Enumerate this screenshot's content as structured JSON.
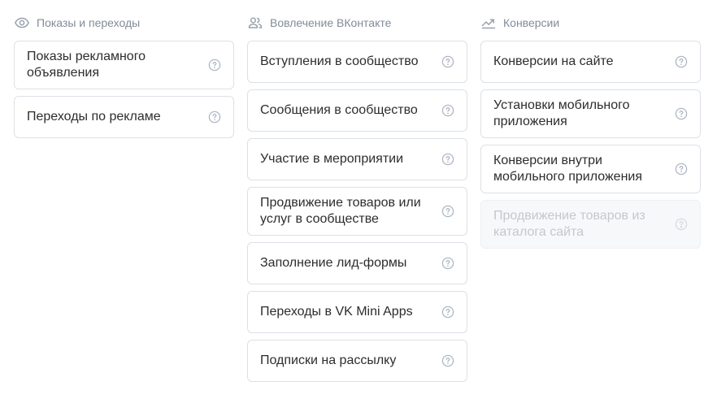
{
  "colors": {
    "header_text": "#818c99",
    "card_border": "#dce1e6",
    "card_text": "#2c2d2e",
    "help_icon": "#aeb7c2",
    "disabled_bg": "#f7f8fa",
    "disabled_text": "#c4c8cc"
  },
  "columns": [
    {
      "title": "Показы и переходы",
      "icon": "eye-icon",
      "items": [
        {
          "label": "Показы рекламного объявления",
          "help_icon": "help-circle-icon",
          "disabled": false
        },
        {
          "label": "Переходы по рекламе",
          "help_icon": "help-circle-icon",
          "disabled": false
        }
      ]
    },
    {
      "title": "Вовлечение ВКонтакте",
      "icon": "users-icon",
      "items": [
        {
          "label": "Вступления в сообщество",
          "help_icon": "help-circle-icon",
          "disabled": false
        },
        {
          "label": "Сообщения в сообщество",
          "help_icon": "help-circle-icon",
          "disabled": false
        },
        {
          "label": "Участие в мероприятии",
          "help_icon": "help-circle-icon",
          "disabled": false
        },
        {
          "label": "Продвижение товаров или услуг в сообществе",
          "help_icon": "help-circle-icon",
          "disabled": false
        },
        {
          "label": "Заполнение лид-формы",
          "help_icon": "help-circle-icon",
          "disabled": false
        },
        {
          "label": "Переходы в VK Mini Apps",
          "help_icon": "help-circle-icon",
          "disabled": false
        },
        {
          "label": "Подписки на рассылку",
          "help_icon": "help-circle-icon",
          "disabled": false
        }
      ]
    },
    {
      "title": "Конверсии",
      "icon": "trending-up-icon",
      "items": [
        {
          "label": "Конверсии на сайте",
          "help_icon": "help-circle-icon",
          "disabled": false
        },
        {
          "label": "Установки мобильного приложения",
          "help_icon": "help-circle-icon",
          "disabled": false
        },
        {
          "label": "Конверсии внутри мобильного приложения",
          "help_icon": "help-circle-icon",
          "disabled": false
        },
        {
          "label": "Продвижение товаров из каталога сайта",
          "help_icon": "help-circle-icon",
          "disabled": true
        }
      ]
    }
  ]
}
